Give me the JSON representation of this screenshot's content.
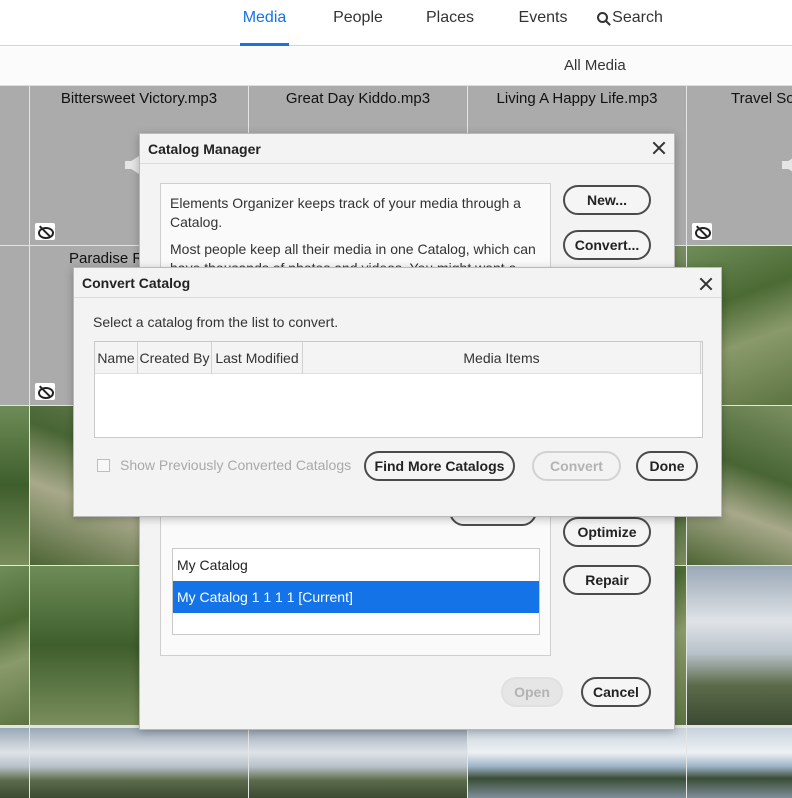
{
  "nav": {
    "tabs": [
      {
        "label": "Media",
        "active": true
      },
      {
        "label": "People"
      },
      {
        "label": "Places"
      },
      {
        "label": "Events"
      }
    ],
    "search_label": "Search",
    "accent_color": "#1473e6"
  },
  "subbar": {
    "label": "All Media"
  },
  "media": {
    "audio_tiles": [
      {
        "name": "Bittersweet Victory.mp3"
      },
      {
        "name": "Great Day Kiddo.mp3"
      },
      {
        "name": "Living A Happy Life.mp3"
      },
      {
        "name": "Travel So"
      },
      {
        "name": "Paradise R"
      }
    ]
  },
  "catalog_manager": {
    "title": "Catalog Manager",
    "description_1": "Elements Organizer keeps track of your media through a Catalog.",
    "description_2": "Most people keep all their media in one Catalog, which can have thousands of photos and videos. You might want a",
    "buttons": {
      "new": "New...",
      "convert": "Convert...",
      "optimize": "Optimize",
      "repair": "Repair",
      "open": "Open",
      "cancel": "Cancel"
    },
    "catalogs": [
      {
        "label": "My Catalog",
        "selected": false
      },
      {
        "label": "My Catalog 1 1 1 1 [Current]",
        "selected": true
      }
    ]
  },
  "convert_catalog": {
    "title": "Convert Catalog",
    "prompt": "Select a catalog from the list to convert.",
    "columns": [
      "Name",
      "Created By",
      "Last Modified",
      "Media Items"
    ],
    "rows": [],
    "show_previous_label": "Show Previously Converted Catalogs",
    "show_previous_checked": false,
    "buttons": {
      "find_more": "Find More Catalogs",
      "convert": "Convert",
      "done": "Done"
    }
  }
}
